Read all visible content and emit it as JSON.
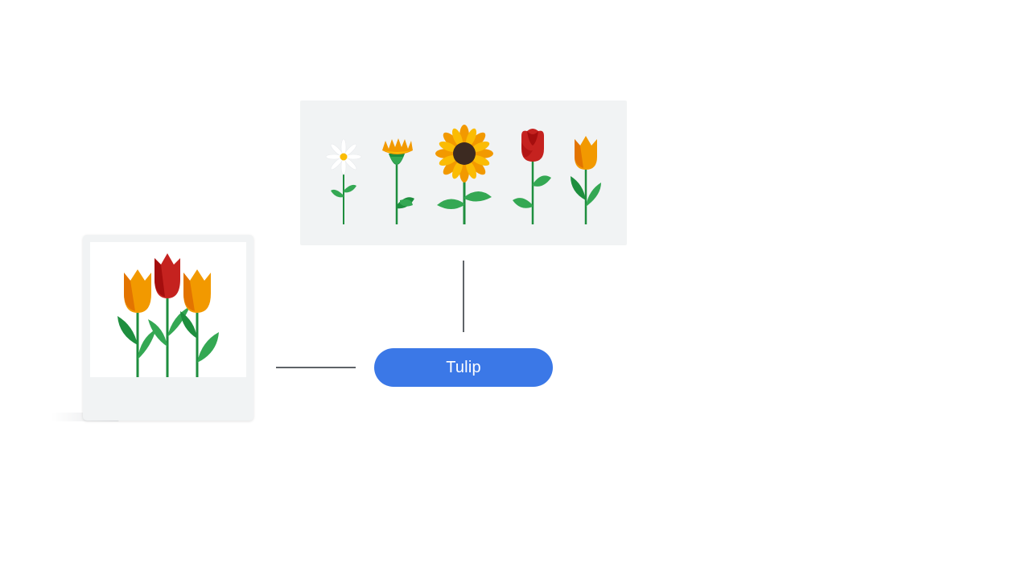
{
  "label": {
    "text": "Tulip"
  },
  "icons": {
    "flower_set": [
      "daisy-icon",
      "marigold-icon",
      "sunflower-icon",
      "rose-icon",
      "tulip-icon"
    ],
    "input_photo": "tulip-bouquet-icon"
  },
  "colors": {
    "pill": "#3b78e7",
    "panel_bg": "#f1f3f4",
    "stem": "#1e8e3e",
    "leaf": "#34a853",
    "orange": "#f29900",
    "red": "#c5221f",
    "yellow": "#fbbc04",
    "seed": "#3c2a21"
  }
}
